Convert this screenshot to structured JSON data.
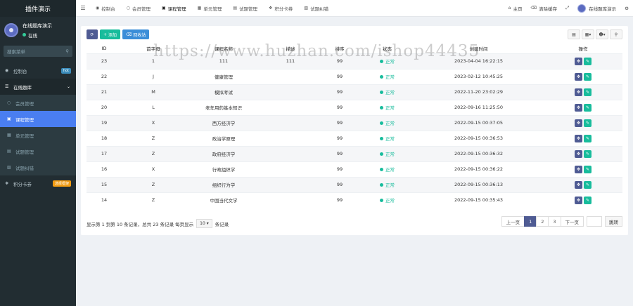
{
  "sidebar": {
    "logo": "插件演示",
    "user_name": "在线题库演示",
    "user_status": "在线",
    "search_placeholder": "搜索菜单",
    "items": [
      {
        "label": "控制台",
        "badge": "hot"
      },
      {
        "label": "在线题库"
      },
      {
        "label": "会员管理"
      },
      {
        "label": "课程管理"
      },
      {
        "label": "单元管理"
      },
      {
        "label": "试题管理"
      },
      {
        "label": "试题纠错"
      },
      {
        "label": "积分卡券",
        "badge": "选择框架"
      }
    ]
  },
  "navbar": {
    "tabs": [
      "控制台",
      "会员管理",
      "课程管理",
      "单元管理",
      "试题管理",
      "积分卡券",
      "试题纠错"
    ],
    "home": "主页",
    "clear_cache": "清除缓存",
    "admin_name": "在线题库演示"
  },
  "toolbar": {
    "add": "添加",
    "delete": "回收站"
  },
  "table": {
    "headers": [
      "ID",
      "首字母",
      "课程名称",
      "描述",
      "排序",
      "状态",
      "创建时间",
      "操作"
    ],
    "rows": [
      {
        "id": "23",
        "letter": "1",
        "name": "111",
        "desc": "111",
        "sort": "99",
        "status": "正常",
        "time": "2023-04-04 16:22:15"
      },
      {
        "id": "22",
        "letter": "J",
        "name": "健康管理",
        "desc": "",
        "sort": "99",
        "status": "正常",
        "time": "2023-02-12 10:45:25"
      },
      {
        "id": "21",
        "letter": "M",
        "name": "模拟考试",
        "desc": "",
        "sort": "99",
        "status": "正常",
        "time": "2022-11-20 23:02:29"
      },
      {
        "id": "20",
        "letter": "L",
        "name": "老年用药基本知识",
        "desc": "",
        "sort": "99",
        "status": "正常",
        "time": "2022-09-16 11:25:50"
      },
      {
        "id": "19",
        "letter": "X",
        "name": "西方经济学",
        "desc": "",
        "sort": "99",
        "status": "正常",
        "time": "2022-09-15 00:37:05"
      },
      {
        "id": "18",
        "letter": "Z",
        "name": "政治学原理",
        "desc": "",
        "sort": "99",
        "status": "正常",
        "time": "2022-09-15 00:36:53"
      },
      {
        "id": "17",
        "letter": "Z",
        "name": "政府经济学",
        "desc": "",
        "sort": "99",
        "status": "正常",
        "time": "2022-09-15 00:36:32"
      },
      {
        "id": "16",
        "letter": "X",
        "name": "行政组织学",
        "desc": "",
        "sort": "99",
        "status": "正常",
        "time": "2022-09-15 00:36:22"
      },
      {
        "id": "15",
        "letter": "Z",
        "name": "组织行为学",
        "desc": "",
        "sort": "99",
        "status": "正常",
        "time": "2022-09-15 00:36:13"
      },
      {
        "id": "14",
        "letter": "Z",
        "name": "中国当代文学",
        "desc": "",
        "sort": "99",
        "status": "正常",
        "time": "2022-09-15 00:35:43"
      }
    ]
  },
  "footer": {
    "info": "显示第 1 到第 10 条记录，总共 23 条记录 每页显示",
    "page_size": "10",
    "suffix": "条记录"
  },
  "pager": {
    "prev": "上一页",
    "pages": [
      "1",
      "2",
      "3"
    ],
    "current": "1",
    "next": "下一页",
    "jump": "跳转"
  },
  "watermark": "https://www.huzhan.com/ishop44435"
}
